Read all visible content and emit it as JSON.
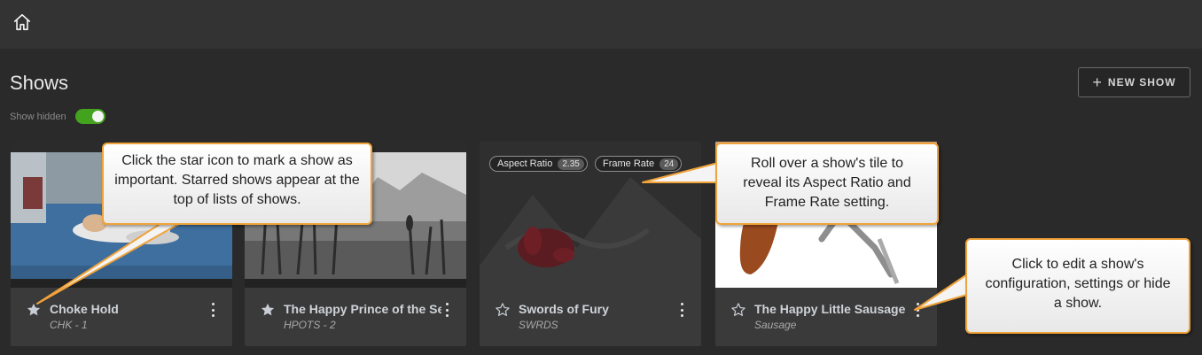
{
  "header": {
    "home_icon": "home-icon"
  },
  "page": {
    "title": "Shows",
    "show_hidden_label": "Show hidden",
    "show_hidden_on": true,
    "new_show_label": "NEW SHOW",
    "accent": "#43a31e"
  },
  "shows": [
    {
      "name": "Choke Hold",
      "code": "CHK - 1",
      "starred": true
    },
    {
      "name": "The Happy Prince of the Sea",
      "code": "HPOTS - 2",
      "starred": true
    },
    {
      "name": "Swords of Fury",
      "code": "SWRDS",
      "starred": false,
      "aspect_ratio_label": "Aspect Ratio",
      "aspect_ratio": "2.35",
      "frame_rate_label": "Frame Rate",
      "frame_rate": "24"
    },
    {
      "name": "The Happy Little Sausage",
      "code": "Sausage",
      "starred": false
    }
  ],
  "callouts": {
    "star": "Click the star icon to mark a show as important. Starred shows appear at the top of lists of shows.",
    "rollover": "Roll over a show's tile to reveal its Aspect Ratio and Frame Rate setting.",
    "edit": "Click to edit a show's configuration, settings or hide a show."
  }
}
